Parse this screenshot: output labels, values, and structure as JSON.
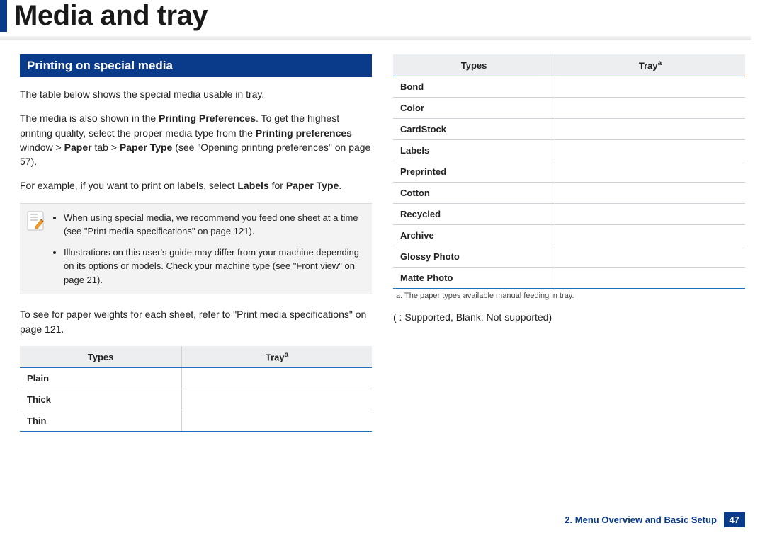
{
  "page": {
    "title": "Media and tray",
    "section_heading": "Printing on special media",
    "intro": "The table below shows the special media usable in tray.",
    "prefs_p1a": "The media is also shown in the ",
    "prefs_bold1": "Printing Preferences",
    "prefs_p1b": ". To get the highest printing quality, select the proper media type from the ",
    "prefs_bold2": "Printing preferences",
    "prefs_p1c": " window > ",
    "prefs_bold3": "Paper",
    "prefs_p1d": " tab > ",
    "prefs_bold4": "Paper Type",
    "prefs_p1e": " (see \"Opening printing preferences\" on page 57).",
    "example_a": "For example, if you want to print on labels, select ",
    "example_bold1": "Labels",
    "example_b": " for ",
    "example_bold2": "Paper Type",
    "example_c": ".",
    "note1": "When using special media, we recommend you feed one sheet at a time (see \"Print media specifications\" on page 121).",
    "note2": "Illustrations on this user's guide may differ from your machine depending on its options or models. Check your machine type (see \"Front view\" on page 21).",
    "weights": "To see for paper weights for each sheet, refer to \"Print media specifications\" on page 121.",
    "th_types": "Types",
    "th_tray": "Tray",
    "th_tray_sup": "a",
    "footnote": "a.  The paper types available manual feeding in tray.",
    "legend": "(   : Supported, Blank: Not supported)",
    "table_left_rows": [
      "Plain",
      "Thick",
      "Thin"
    ],
    "table_right_rows": [
      "Bond",
      "Color",
      "CardStock",
      "Labels",
      "Preprinted",
      "Cotton",
      "Recycled",
      "Archive",
      "Glossy Photo",
      "Matte Photo"
    ],
    "footer_chapter": "2. Menu Overview and Basic Setup",
    "footer_page": "47"
  }
}
